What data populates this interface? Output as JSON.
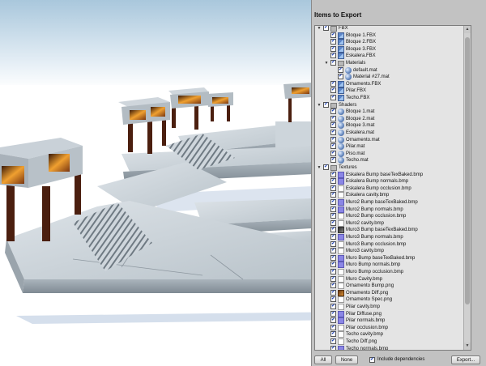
{
  "panel": {
    "title": "Items to Export",
    "buttons": {
      "all": "All",
      "none": "None",
      "export": "Export..."
    },
    "include_dependencies": {
      "label": "Include dependencies",
      "checked": true
    }
  },
  "tree": [
    {
      "depth": 1,
      "arrow": "down",
      "icon": "folder-icon",
      "label": "FBX",
      "checked": true
    },
    {
      "depth": 2,
      "icon": "mesh-icon",
      "label": "Bloque 1.FBX",
      "checked": true
    },
    {
      "depth": 2,
      "icon": "mesh-icon",
      "label": "Bloque 2.FBX",
      "checked": true
    },
    {
      "depth": 2,
      "icon": "mesh-icon",
      "label": "Bloque 3.FBX",
      "checked": true
    },
    {
      "depth": 2,
      "icon": "mesh-icon",
      "label": "Eskalera.FBX",
      "checked": true
    },
    {
      "depth": 2,
      "arrow": "down",
      "icon": "folder-icon",
      "label": "Materials",
      "checked": true
    },
    {
      "depth": 3,
      "icon": "material-icon",
      "label": "default.mat",
      "checked": true
    },
    {
      "depth": 3,
      "icon": "material-icon",
      "label": "Material #27.mat",
      "checked": true
    },
    {
      "depth": 2,
      "icon": "mesh-icon",
      "label": "Ornamento.FBX",
      "checked": true
    },
    {
      "depth": 2,
      "icon": "mesh-icon",
      "label": "Pilar.FBX",
      "checked": true
    },
    {
      "depth": 2,
      "icon": "mesh-icon",
      "label": "Techo.FBX",
      "checked": true
    },
    {
      "depth": 1,
      "arrow": "down",
      "icon": "folder-icon",
      "label": "Shaders",
      "checked": true
    },
    {
      "depth": 2,
      "icon": "material-icon",
      "label": "Bloque 1.mat",
      "checked": true
    },
    {
      "depth": 2,
      "icon": "material-icon",
      "label": "Bloque 2.mat",
      "checked": true
    },
    {
      "depth": 2,
      "icon": "material-icon",
      "label": "Bloque 3.mat",
      "checked": true
    },
    {
      "depth": 2,
      "icon": "material-icon",
      "label": "Eskalera.mat",
      "checked": true
    },
    {
      "depth": 2,
      "icon": "material-icon",
      "label": "Ornamento.mat",
      "checked": true
    },
    {
      "depth": 2,
      "icon": "material-icon",
      "label": "Pilar.mat",
      "checked": true
    },
    {
      "depth": 2,
      "icon": "material-icon",
      "label": "Piso.mat",
      "checked": true
    },
    {
      "depth": 2,
      "icon": "material-icon",
      "label": "Techo.mat",
      "checked": true
    },
    {
      "depth": 1,
      "arrow": "down",
      "icon": "folder-icon",
      "label": "Textures",
      "checked": true
    },
    {
      "depth": 2,
      "icon": "texture-blue-icon",
      "label": "Eskalera Bump baseTexBaked.bmp",
      "checked": true
    },
    {
      "depth": 2,
      "icon": "texture-blue-icon",
      "label": "Eskalera Bump normals.bmp",
      "checked": true
    },
    {
      "depth": 2,
      "icon": "texture-white-icon",
      "label": "Eskalera Bump occlusion.bmp",
      "checked": true
    },
    {
      "depth": 2,
      "icon": "texture-white-icon",
      "label": "Eskalera cavity.bmp",
      "checked": true
    },
    {
      "depth": 2,
      "icon": "texture-blue-icon",
      "label": "Muro2 Bump baseTexBaked.bmp",
      "checked": true
    },
    {
      "depth": 2,
      "icon": "texture-blue-icon",
      "label": "Muro2 Bump normals.bmp",
      "checked": true
    },
    {
      "depth": 2,
      "icon": "texture-white-icon",
      "label": "Muro2 Bump occlusion.bmp",
      "checked": true
    },
    {
      "depth": 2,
      "icon": "texture-white-icon",
      "label": "Muro2 cavity.bmp",
      "checked": true
    },
    {
      "depth": 2,
      "icon": "texture-dark-icon",
      "label": "Muro3 Bump baseTexBaked.bmp",
      "checked": true
    },
    {
      "depth": 2,
      "icon": "texture-blue-icon",
      "label": "Muro3 Bump normals.bmp",
      "checked": true
    },
    {
      "depth": 2,
      "icon": "texture-white-icon",
      "label": "Muro3 Bump occlusion.bmp",
      "checked": true
    },
    {
      "depth": 2,
      "icon": "texture-white-icon",
      "label": "Muro3 cavity.bmp",
      "checked": true
    },
    {
      "depth": 2,
      "icon": "texture-blue-icon",
      "label": "Muro Bump baseTexBaked.bmp",
      "checked": true
    },
    {
      "depth": 2,
      "icon": "texture-blue-icon",
      "label": "Muro Bump normals.bmp",
      "checked": true
    },
    {
      "depth": 2,
      "icon": "texture-white-icon",
      "label": "Muro Bump occlusion.bmp",
      "checked": true
    },
    {
      "depth": 2,
      "icon": "texture-white-icon",
      "label": "Muro Cavity.bmp",
      "checked": true
    },
    {
      "depth": 2,
      "icon": "texture-white-icon",
      "label": "Ornamento Bump.png",
      "checked": true
    },
    {
      "depth": 2,
      "icon": "texture-orange-icon",
      "label": "Ornamento Diff.png",
      "checked": true
    },
    {
      "depth": 2,
      "icon": "texture-white-icon",
      "label": "Ornamento Spec.png",
      "checked": true
    },
    {
      "depth": 2,
      "icon": "texture-white-icon",
      "label": "Pilar cavity.bmp",
      "checked": true
    },
    {
      "depth": 2,
      "icon": "texture-blue-icon",
      "label": "Pilar Diffuse.png",
      "checked": true
    },
    {
      "depth": 2,
      "icon": "texture-blue-icon",
      "label": "Pilar normals.bmp",
      "checked": true
    },
    {
      "depth": 2,
      "icon": "texture-white-icon",
      "label": "Pilar occlusion.bmp",
      "checked": true
    },
    {
      "depth": 2,
      "icon": "texture-white-icon",
      "label": "Techo cavity.bmp",
      "checked": true
    },
    {
      "depth": 2,
      "icon": "texture-white-icon",
      "label": "Techo Diff.png",
      "checked": true
    },
    {
      "depth": 2,
      "icon": "texture-blue-icon",
      "label": "Techo normals.bmp",
      "checked": true
    }
  ],
  "colors": {
    "sky_top": "#a8c6dc",
    "sky_bottom": "#ffffff",
    "stone": "#c7cfd6",
    "stone_dark": "#8c979f",
    "wood": "#5a2a16",
    "panel_bg": "#c2c2c2",
    "check_accent": "#1a3fb5"
  }
}
